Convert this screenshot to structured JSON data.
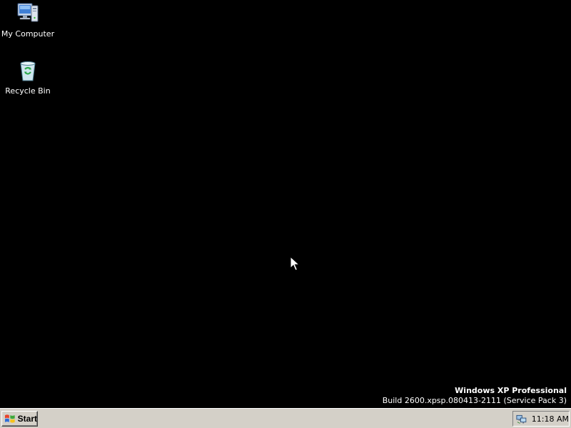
{
  "desktop": {
    "background": "#000000",
    "icons": [
      {
        "label": "My Computer",
        "icon": "my-computer-icon"
      },
      {
        "label": "Recycle Bin",
        "icon": "recycle-bin-icon"
      }
    ],
    "watermark": {
      "title": "Windows XP Professional",
      "build": "Build 2600.xpsp.080413-2111 (Service Pack 3)"
    }
  },
  "taskbar": {
    "background": "#d4d0c8",
    "start_label": "Start",
    "tray": {
      "icons": [
        "network-icon"
      ],
      "clock": "11:18 AM"
    }
  }
}
